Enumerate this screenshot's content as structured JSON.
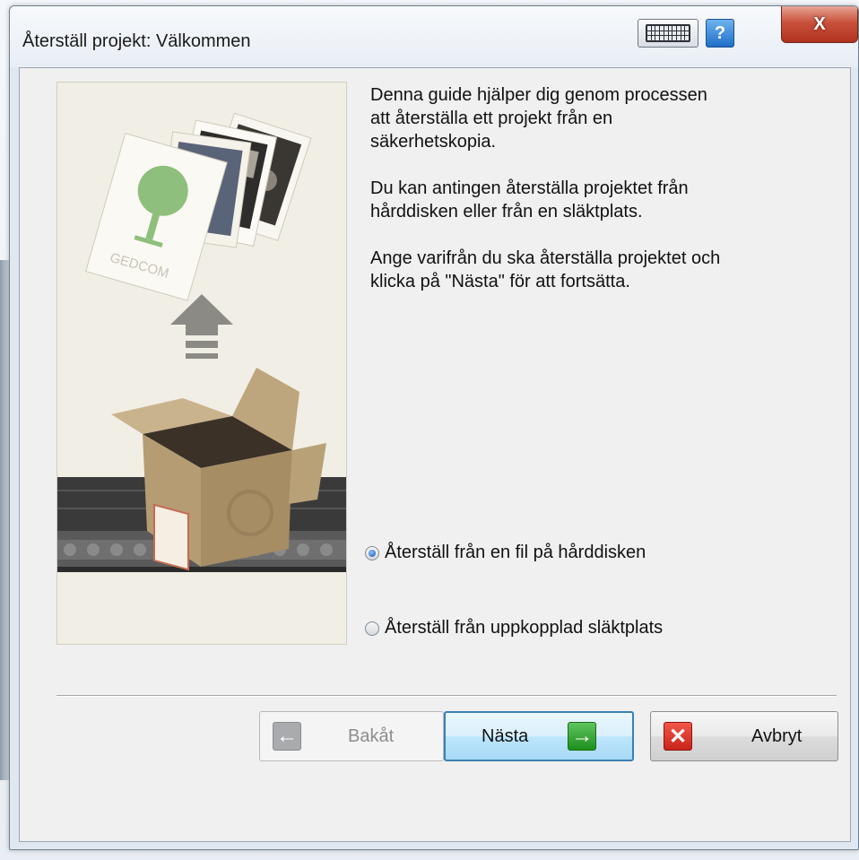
{
  "window": {
    "title": "Återställ projekt: Välkommen",
    "help_glyph": "?",
    "close_glyph": "X"
  },
  "illustration": {
    "card_text": "GEDCOM"
  },
  "description": {
    "paragraph1": "Denna guide hjälper dig genom processen\natt återställa ett projekt från en\nsäkerhetskopia.",
    "paragraph2": "Du kan antingen återställa projektet från\nhårddisken eller från en släktplats.",
    "paragraph3": "Ange varifrån du ska återställa projektet och\nklicka på \"Nästa\" för att fortsätta."
  },
  "options": {
    "selected": "local",
    "local_label": "Återställ från en fil på hårddisken",
    "online_label": "Återställ från uppkopplad släktplats"
  },
  "buttons": {
    "back_label": "Bakåt",
    "next_label": "Nästa",
    "cancel_label": "Avbryt",
    "back_glyph": "←",
    "next_glyph": "→",
    "cancel_glyph": "✕"
  },
  "colors": {
    "accent_blue": "#3c7fb1",
    "next_green": "#1d8f1d",
    "cancel_red": "#c9231a",
    "close_red": "#b1321d"
  },
  "icons": [
    "keyboard-icon",
    "help-icon",
    "close-icon",
    "arrow-left-icon",
    "arrow-right-icon",
    "cancel-x-icon",
    "upload-arrow-icon",
    "box-icon"
  ]
}
